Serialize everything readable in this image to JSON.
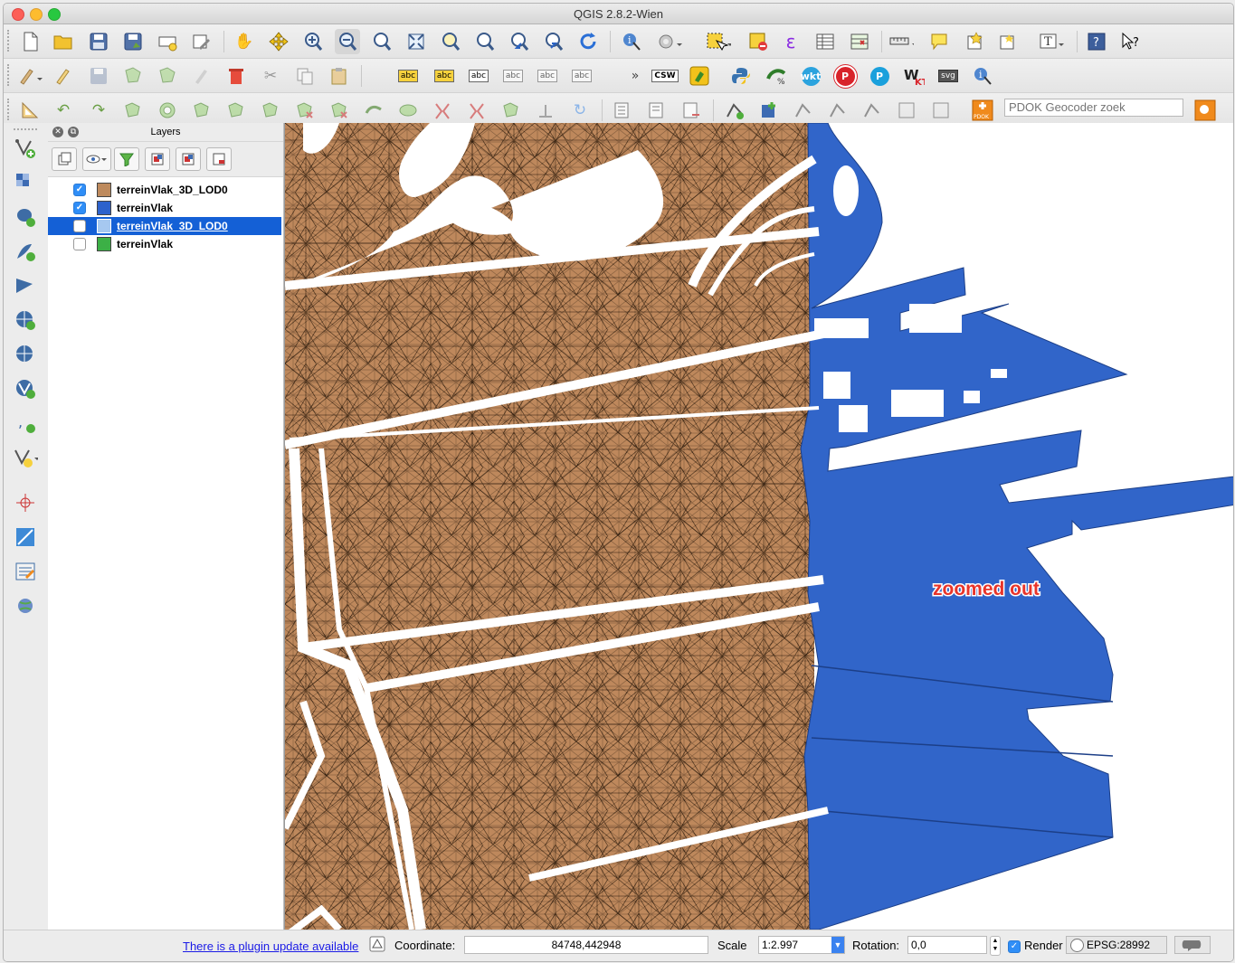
{
  "window": {
    "title": "QGIS 2.8.2-Wien"
  },
  "toolbar": {
    "row1_icons": [
      "new-project-icon",
      "open-project-icon",
      "save-project-icon",
      "save-as-icon",
      "new-print-composer-icon",
      "composer-manager-icon",
      "pan-icon",
      "pan-to-selection-icon",
      "zoom-in-icon",
      "zoom-out-icon",
      "zoom-native-icon",
      "zoom-full-icon",
      "zoom-to-selection-icon",
      "zoom-to-layer-icon",
      "zoom-last-icon",
      "zoom-next-icon",
      "refresh-icon",
      "identify-icon",
      "action-icon",
      "select-icon",
      "deselect-icon",
      "expression-select-icon",
      "attribute-table-icon",
      "field-calculator-icon",
      "measure-icon",
      "map-tips-icon",
      "new-bookmark-icon",
      "show-bookmarks-icon",
      "text-annotation-icon",
      "help-icon",
      "whats-this-icon"
    ],
    "expression_glyph": "ε",
    "row2_labels": {
      "abc": "abc",
      "csw": "CSW",
      "wkt": "wkt",
      "p": "P",
      "svg": "svg",
      "chevron": "»"
    },
    "geocoder_placeholder": "PDOK Geocoder zoek",
    "pdok_label": "PDOK"
  },
  "layers_panel": {
    "title": "Layers",
    "layers": [
      {
        "name": "terreinVlak_3D_LOD0",
        "checked": true,
        "color": "#be8a5d",
        "selected": false
      },
      {
        "name": "terreinVlak",
        "checked": true,
        "color": "#2d62cc",
        "selected": false
      },
      {
        "name": "terreinVlak_3D_LOD0",
        "checked": false,
        "color": "#a6c8f0",
        "selected": true
      },
      {
        "name": "terreinVlak",
        "checked": false,
        "color": "#3cb046",
        "selected": false
      }
    ]
  },
  "map": {
    "annotation": "zoomed out",
    "terrain_color": "#c08a5e",
    "water_color": "#3165c9"
  },
  "status": {
    "plugin_update": "There is a plugin update available",
    "coordinate_label": "Coordinate:",
    "coordinate_value": "84748,442948",
    "scale_label": "Scale",
    "scale_value": "1:2.997",
    "rotation_label": "Rotation:",
    "rotation_value": "0,0",
    "render_label": "Render",
    "render_checked": true,
    "crs": "EPSG:28992"
  }
}
